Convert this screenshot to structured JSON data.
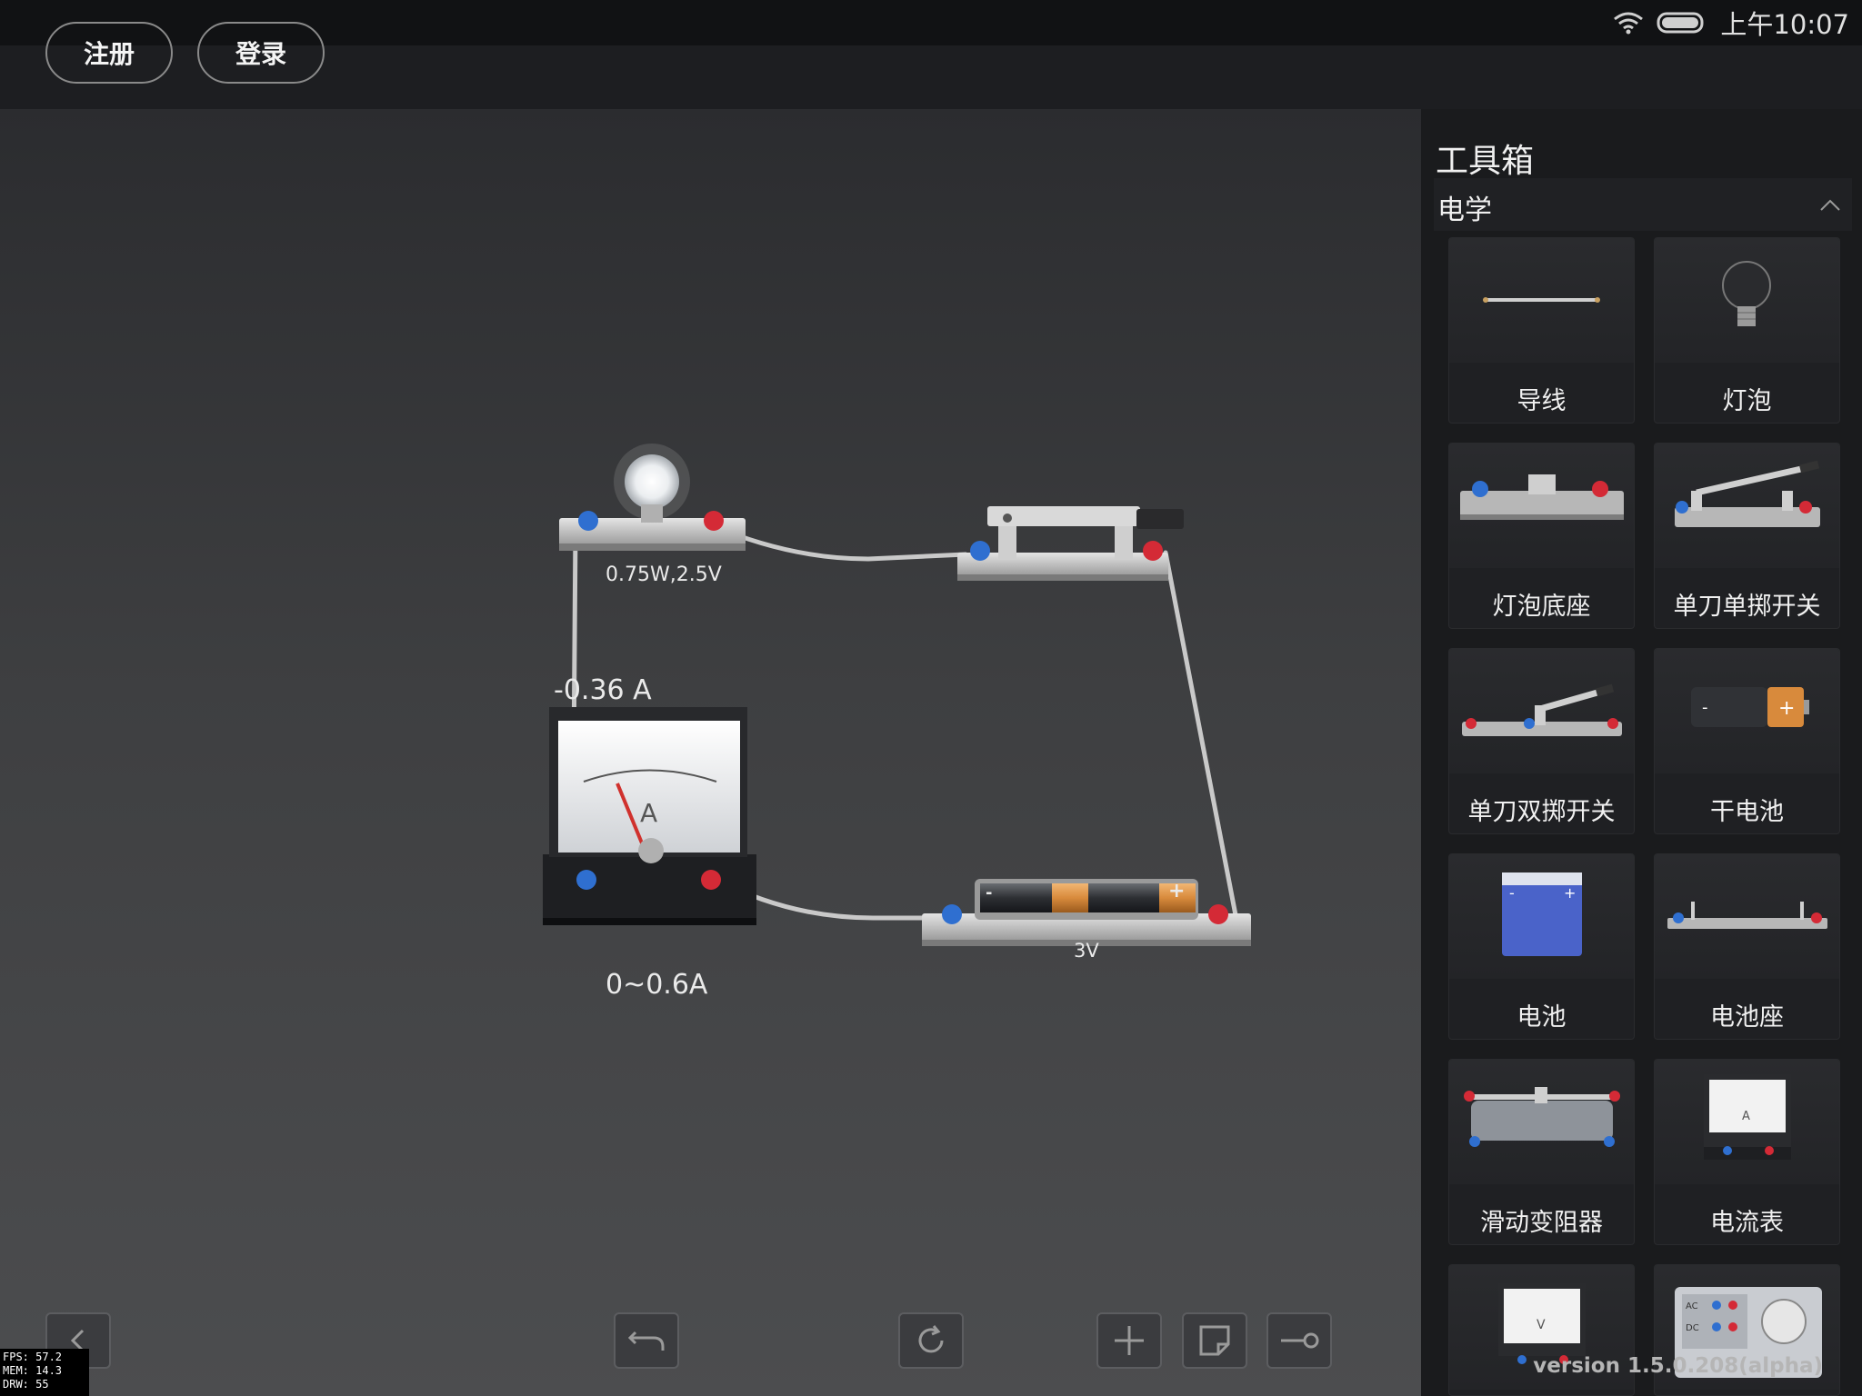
{
  "status_bar": {
    "time": "上午10:07",
    "wifi_icon": "wifi-icon",
    "battery_icon": "battery-icon"
  },
  "header": {
    "register_label": "注册",
    "login_label": "登录"
  },
  "circuit": {
    "bulb_rating": "0.75W,2.5V",
    "ammeter_reading": "-0.36 A",
    "ammeter_dial_letter": "A",
    "ammeter_range": "0~0.6A",
    "battery_voltage": "3V",
    "battery_minus": "-",
    "battery_plus": "+"
  },
  "debug": {
    "fps": "FPS: 57.2",
    "mem": "MEM: 14.3",
    "draw": "DRW: 55"
  },
  "toolbox": {
    "title": "工具箱",
    "section": "电学",
    "items": [
      {
        "label": "导线",
        "icon": "wire-icon"
      },
      {
        "label": "灯泡",
        "icon": "bulb-icon"
      },
      {
        "label": "灯泡底座",
        "icon": "bulb-base-icon"
      },
      {
        "label": "单刀单掷开关",
        "icon": "spst-switch-icon"
      },
      {
        "label": "单刀双掷开关",
        "icon": "spdt-switch-icon"
      },
      {
        "label": "干电池",
        "icon": "dry-cell-icon"
      },
      {
        "label": "电池",
        "icon": "battery-pack-icon"
      },
      {
        "label": "电池座",
        "icon": "battery-holder-icon"
      },
      {
        "label": "滑动变阻器",
        "icon": "rheostat-icon"
      },
      {
        "label": "电流表",
        "icon": "ammeter-icon"
      },
      {
        "label": "",
        "icon": "voltmeter-icon"
      },
      {
        "label": "",
        "icon": "power-supply-icon"
      }
    ],
    "voltmeter_letter": "V",
    "ammeter_letter": "A",
    "power_ac": "AC",
    "power_dc": "DC"
  },
  "version": "version 1.5.0.208(alpha)",
  "toolbar_icons": [
    "back-icon",
    "undo-icon",
    "refresh-icon",
    "add-icon",
    "note-icon",
    "probe-icon"
  ],
  "colors": {
    "terminal_blue": "#2f6fd0",
    "terminal_red": "#d42a36",
    "wire": "#c9c9c9",
    "needle": "#d0312d"
  }
}
